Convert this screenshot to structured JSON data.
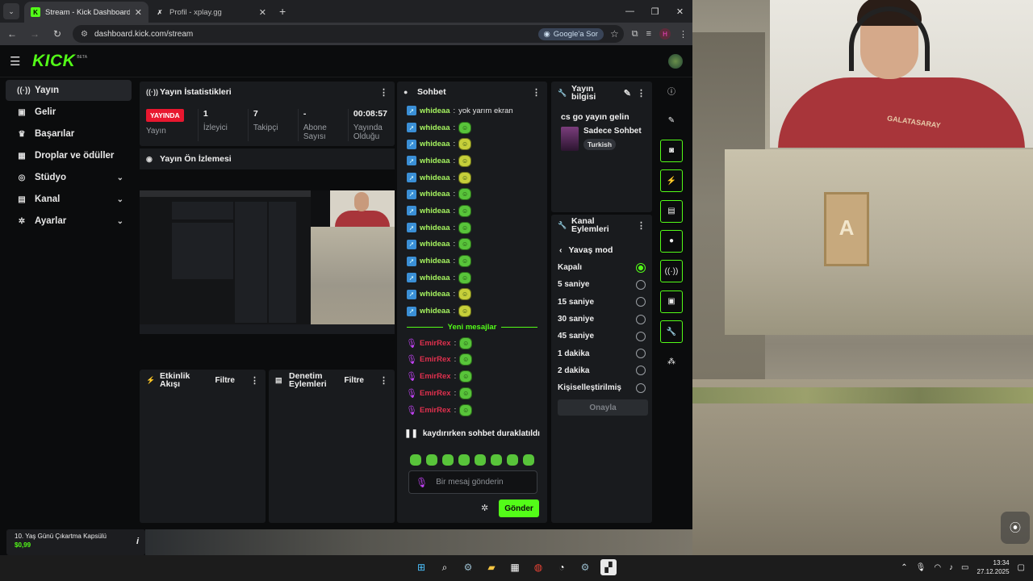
{
  "browser": {
    "tabs": [
      {
        "title": "Stream - Kick Dashboard",
        "favicon": "kick-icon"
      },
      {
        "title": "Profil - xplay.gg",
        "favicon": "xplay-icon"
      }
    ],
    "url": "dashboard.kick.com/stream",
    "google_pill": "Google'a Sor",
    "profile_initial": "H"
  },
  "kick": {
    "logo": "KICK",
    "beta": "BETA",
    "sidebar": [
      {
        "label": "Yayın",
        "icon": "broadcast-icon",
        "active": true,
        "expand": false
      },
      {
        "label": "Gelir",
        "icon": "revenue-icon",
        "active": false,
        "expand": false
      },
      {
        "label": "Başarılar",
        "icon": "trophy-icon",
        "active": false,
        "expand": false
      },
      {
        "label": "Droplar ve ödüller",
        "icon": "gift-icon",
        "active": false,
        "expand": false
      },
      {
        "label": "Stüdyo",
        "icon": "studio-icon",
        "active": false,
        "expand": true
      },
      {
        "label": "Kanal",
        "icon": "channel-icon",
        "active": false,
        "expand": true
      },
      {
        "label": "Ayarlar",
        "icon": "gear-icon",
        "active": false,
        "expand": true
      }
    ],
    "stats": {
      "title": "Yayın İstatistikleri",
      "live_badge": "YAYINDA",
      "items": [
        {
          "value": "",
          "label": "Yayın"
        },
        {
          "value": "1",
          "label": "İzleyici"
        },
        {
          "value": "7",
          "label": "Takipçi"
        },
        {
          "value": "-",
          "label": "Abone Sayısı"
        },
        {
          "value": "00:08:57",
          "label": "Yayında Olduğu"
        }
      ]
    },
    "preview": {
      "title": "Yayın Ön İzlemesi"
    },
    "activity": {
      "title": "Etkinlik Akışı",
      "filter": "Filtre"
    },
    "moderation": {
      "title": "Denetim Eylemleri",
      "filter": "Filtre"
    },
    "chat": {
      "title": "Sohbet",
      "messages": [
        {
          "user": "whideaa",
          "text": "yok yarım ekran",
          "emote": ""
        },
        {
          "user": "whideaa",
          "text": "",
          "emote": "g"
        },
        {
          "user": "whideaa",
          "text": "",
          "emote": "y"
        },
        {
          "user": "whideaa",
          "text": "",
          "emote": "y"
        },
        {
          "user": "whideaa",
          "text": "",
          "emote": "y"
        },
        {
          "user": "whideaa",
          "text": "",
          "emote": "g"
        },
        {
          "user": "whideaa",
          "text": "",
          "emote": "g"
        },
        {
          "user": "whideaa",
          "text": "",
          "emote": "g"
        },
        {
          "user": "whideaa",
          "text": "",
          "emote": "g"
        },
        {
          "user": "whideaa",
          "text": "",
          "emote": "g"
        },
        {
          "user": "whideaa",
          "text": "",
          "emote": "g"
        },
        {
          "user": "whideaa",
          "text": "",
          "emote": "y"
        },
        {
          "user": "whideaa",
          "text": "",
          "emote": "y"
        }
      ],
      "new_messages_label": "Yeni mesajlar",
      "new_messages": [
        {
          "user": "EmirRex"
        },
        {
          "user": "EmirRex"
        },
        {
          "user": "EmirRex"
        },
        {
          "user": "EmirRex"
        },
        {
          "user": "EmirRex"
        }
      ],
      "paused_label": "kaydırırken sohbet duraklatıldı",
      "input_placeholder": "Bir mesaj gönderin",
      "send_label": "Gönder"
    },
    "stream_info": {
      "title": "Yayın bilgisi",
      "stream_title": "cs go yayın gelin",
      "category": "Sadece Sohbet",
      "tag": "Turkish"
    },
    "channel_actions": {
      "title": "Kanal Eylemleri",
      "section": "Yavaş mod",
      "options": [
        {
          "label": "Kapalı",
          "selected": true
        },
        {
          "label": "5 saniye",
          "selected": false
        },
        {
          "label": "15 saniye",
          "selected": false
        },
        {
          "label": "30 saniye",
          "selected": false
        },
        {
          "label": "45 saniye",
          "selected": false
        },
        {
          "label": "1 dakika",
          "selected": false
        },
        {
          "label": "2 dakika",
          "selected": false
        },
        {
          "label": "Kişiselleştirilmiş",
          "selected": false
        }
      ],
      "approve_label": "Onayla"
    },
    "right_toolbar": [
      "info-icon",
      "pencil-icon",
      "camera-icon",
      "lightning-icon",
      "notes-icon",
      "chat-bubble-icon",
      "broadcast-signal-icon",
      "media-icon",
      "wrench-icon",
      "dots-icon"
    ]
  },
  "store_card": {
    "name": "10. Yaş Günü Çıkartma Kapsülü",
    "price": "$0,99"
  },
  "game": {
    "sign_letter": "A",
    "shirt_text": "GALATASARAY"
  },
  "taskbar": {
    "time": "13:34",
    "date": "27.12.2025"
  },
  "colors": {
    "accent": "#53fc18",
    "live": "#e8172f",
    "panel": "#191b1e",
    "bg": "#0b0c0d"
  }
}
